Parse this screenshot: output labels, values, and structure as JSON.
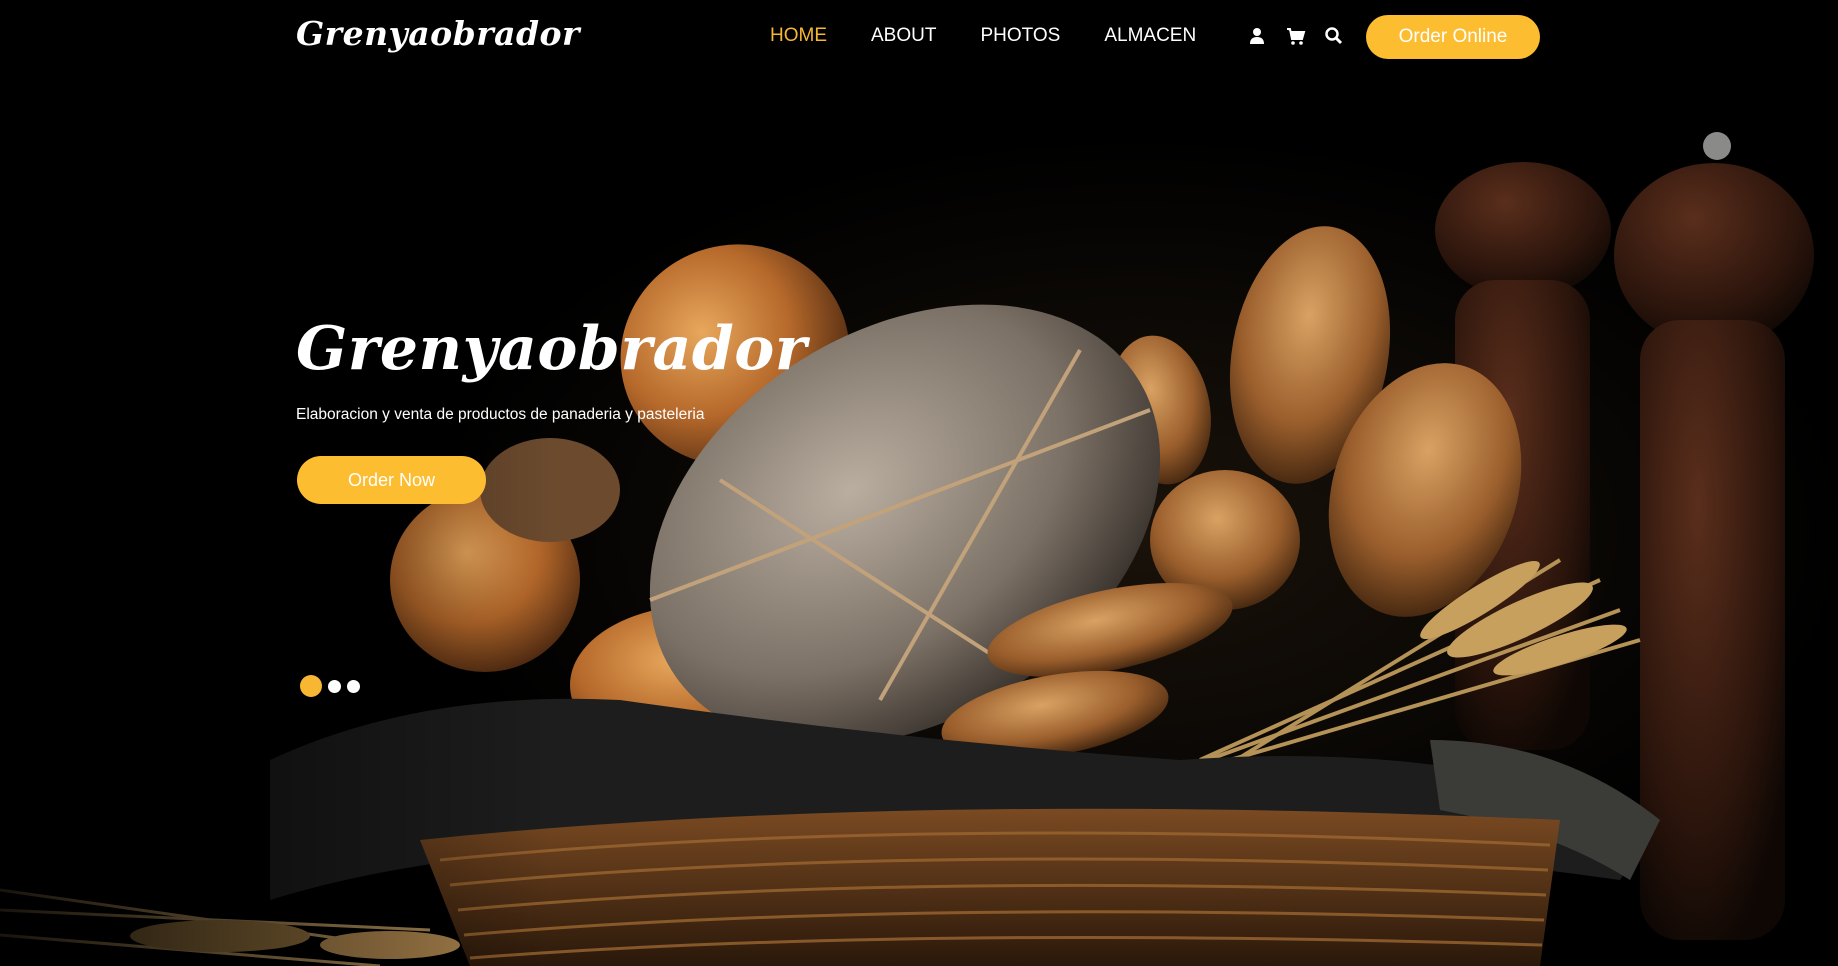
{
  "brand": {
    "name": "Grenyaobrador"
  },
  "nav": {
    "items": [
      {
        "label": "HOME",
        "active": true
      },
      {
        "label": "ABOUT",
        "active": false
      },
      {
        "label": "PHOTOS",
        "active": false
      },
      {
        "label": "ALMACEN",
        "active": false
      }
    ]
  },
  "header_icons": [
    "user-icon",
    "cart-icon",
    "search-icon"
  ],
  "header_button": {
    "label": "Order Online"
  },
  "hero": {
    "title": "Grenyaobrador",
    "subtitle": "Elaboracion y venta de productos de panaderia y pasteleria",
    "button_label": "Order Now",
    "slides": 3,
    "active_slide": 1
  },
  "colors": {
    "accent": "#fdbd31",
    "active_nav": "#f7b733",
    "background": "#000000"
  }
}
